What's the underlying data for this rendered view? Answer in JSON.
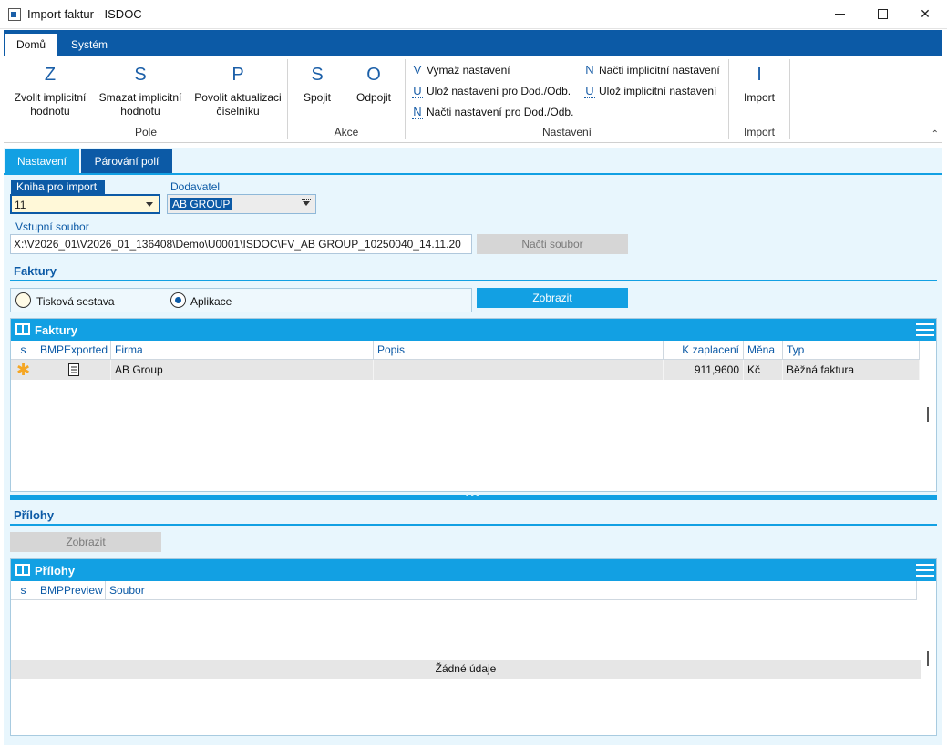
{
  "window": {
    "title": "Import faktur - ISDOC",
    "minimize": "—",
    "maximize": "☐",
    "close": "✕"
  },
  "ribbon_tabs": [
    "Domů",
    "Systém"
  ],
  "ribbon": {
    "pole": {
      "label": "Pole",
      "buttons": [
        {
          "letter": "Z",
          "line1": "Zvolit implicitní",
          "line2": "hodnotu"
        },
        {
          "letter": "S",
          "line1": "Smazat implicitní",
          "line2": "hodnotu"
        },
        {
          "letter": "P",
          "line1": "Povolit aktualizaci",
          "line2": "číselníku"
        }
      ]
    },
    "akce": {
      "label": "Akce",
      "buttons": [
        {
          "letter": "S",
          "line1": "Spojit"
        },
        {
          "letter": "O",
          "line1": "Odpojit"
        }
      ]
    },
    "nastaveni": {
      "label": "Nastavení",
      "buttons": [
        {
          "letter": "V",
          "text": "Vymaž nastavení"
        },
        {
          "letter": "U",
          "text": "Ulož nastavení pro Dod./Odb."
        },
        {
          "letter": "N",
          "text": "Načti nastavení pro Dod./Odb."
        },
        {
          "letter": "N",
          "text": "Načti implicitní nastavení"
        },
        {
          "letter": "U",
          "text": "Ulož implicitní nastavení"
        }
      ]
    },
    "import": {
      "label": "Import",
      "button": {
        "letter": "I",
        "line1": "Import"
      }
    },
    "collapse_icon": "⌃"
  },
  "content_tabs": [
    "Nastavení",
    "Párování polí"
  ],
  "form": {
    "kniha_label": "Kniha pro import",
    "kniha_value": "11",
    "dodavatel_label": "Dodavatel",
    "dodavatel_value": "AB GROUP",
    "vstupni_label": "Vstupní soubor",
    "vstupni_value": "X:\\V2026_01\\V2026_01_136408\\Demo\\U0001\\ISDOC\\FV_AB GROUP_10250040_14.11.20",
    "nacti_button": "Načti soubor"
  },
  "faktury_section": {
    "title": "Faktury",
    "radio_options": [
      "Tisková sestava",
      "Aplikace"
    ],
    "selected_radio": "Aplikace",
    "zobrazit_button": "Zobrazit"
  },
  "faktury_grid": {
    "title": "Faktury",
    "columns": [
      "s",
      "BMPExported",
      "Firma",
      "Popis",
      "K zaplacení",
      "Měna",
      "Typ"
    ],
    "rows": [
      {
        "s": "✱",
        "bmp": "doc-icon",
        "firma": "AB Group",
        "popis": "",
        "k_zaplaceni": "911,9600",
        "mena": "Kč",
        "typ": "Běžná faktura"
      }
    ]
  },
  "prilohy_section": {
    "title": "Přílohy",
    "zobrazit_button": "Zobrazit"
  },
  "prilohy_grid": {
    "title": "Přílohy",
    "columns": [
      "s",
      "BMPPreview",
      "Soubor"
    ],
    "empty_text": "Žádné údaje"
  }
}
